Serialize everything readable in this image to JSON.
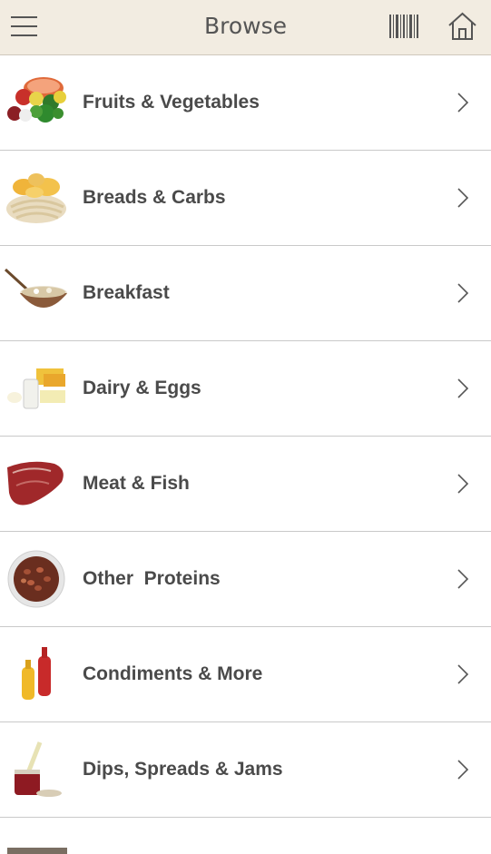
{
  "header": {
    "title": "Browse",
    "menu_icon": "hamburger-menu-icon",
    "barcode_icon": "barcode-icon",
    "home_icon": "home-icon",
    "background": "#f2ece1"
  },
  "categories": [
    {
      "label": "Fruits & Vegetables",
      "icon": "fruits-vegetables-image"
    },
    {
      "label": "Breads & Carbs",
      "icon": "breads-carbs-image"
    },
    {
      "label": "Breakfast",
      "icon": "breakfast-bowl-image"
    },
    {
      "label": "Dairy & Eggs",
      "icon": "dairy-eggs-image"
    },
    {
      "label": "Meat & Fish",
      "icon": "steak-image"
    },
    {
      "label": "Other  Proteins",
      "icon": "beans-bowl-image"
    },
    {
      "label": "Condiments & More",
      "icon": "condiment-bottles-image"
    },
    {
      "label": "Dips, Spreads & Jams",
      "icon": "jam-jar-image"
    }
  ]
}
